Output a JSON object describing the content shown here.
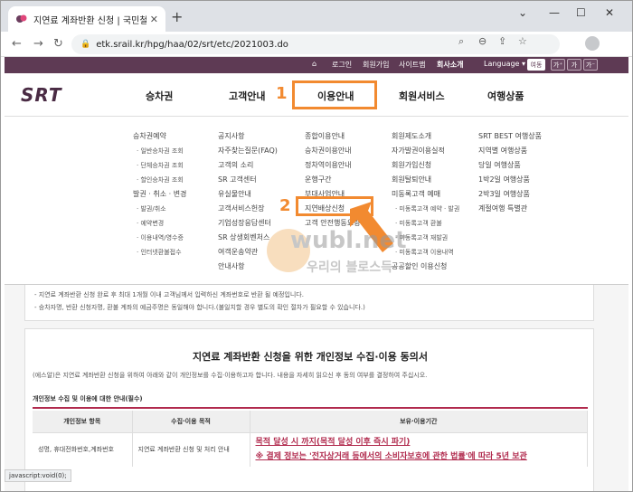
{
  "browser": {
    "tab_title": "지연료 계좌반환 신청 | 국민철도",
    "tab_close": "✕",
    "new_tab": "+",
    "url": "etk.srail.kr/hpg/haa/02/srt/etc/2021003.do",
    "status_text": "javascript:void(0);"
  },
  "utility": {
    "home_icon": "home-icon",
    "items": [
      "로그인",
      "회원가입",
      "사이트맵",
      "회사소개",
      "Language"
    ],
    "lang_arrow": "▾",
    "buttons": [
      "여동",
      "가⁺",
      "가",
      "가⁻"
    ]
  },
  "logo": "SRT",
  "nav": {
    "items": [
      "승차권",
      "고객안내",
      "이용안내",
      "회원서비스",
      "여행상품"
    ],
    "step1": "1",
    "step2": "2"
  },
  "mega": {
    "col1": [
      {
        "label": "승차권예약",
        "sub": false
      },
      {
        "label": "일반승차권 조회",
        "sub": true
      },
      {
        "label": "단체승차권 조회",
        "sub": true
      },
      {
        "label": "할인승차권 조회",
        "sub": true
      },
      {
        "label": "발권 · 취소 · 변경",
        "sub": false
      },
      {
        "label": "발권/취소",
        "sub": true
      },
      {
        "label": "예약변경",
        "sub": true
      },
      {
        "label": "이용내역/영수증",
        "sub": true
      },
      {
        "label": "인터넷환불접수",
        "sub": true
      }
    ],
    "col2": [
      {
        "label": "공지사항",
        "sub": false
      },
      {
        "label": "자주찾는질문(FAQ)",
        "sub": false
      },
      {
        "label": "고객의 소리",
        "sub": false
      },
      {
        "label": "SR 고객센터",
        "sub": false
      },
      {
        "label": "유실물안내",
        "sub": false
      },
      {
        "label": "고객서비스헌장",
        "sub": false
      },
      {
        "label": "기업성장응답센터",
        "sub": false
      },
      {
        "label": "SR 상생회벤처스",
        "sub": false
      },
      {
        "label": "여객운송약관",
        "sub": false
      },
      {
        "label": "안내사항",
        "sub": false
      }
    ],
    "col3": [
      {
        "label": "종합이용안내",
        "sub": false
      },
      {
        "label": "승차권이용안내",
        "sub": false
      },
      {
        "label": "정차역이용안내",
        "sub": false
      },
      {
        "label": "운행구간",
        "sub": false
      },
      {
        "label": "부대사업안내",
        "sub": false
      },
      {
        "label": "지연배상신청",
        "sub": false
      },
      {
        "label": "고객 안전행동요령",
        "sub": false
      }
    ],
    "col4": [
      {
        "label": "회원제도소개",
        "sub": false
      },
      {
        "label": "자가발권이용실적",
        "sub": false
      },
      {
        "label": "회원가입신청",
        "sub": false
      },
      {
        "label": "회원탈퇴안내",
        "sub": false
      },
      {
        "label": "미동록고객 예매",
        "sub": false
      },
      {
        "label": "미동록고객 예약 · 발권",
        "sub": true
      },
      {
        "label": "미동록고객 환불",
        "sub": true
      },
      {
        "label": "미동록고객 재발권",
        "sub": true
      },
      {
        "label": "미동록고객 이용내역",
        "sub": true
      },
      {
        "label": "공공할인 이용신청",
        "sub": false
      }
    ],
    "col5": [
      {
        "label": "SRT BEST 여행상품",
        "sub": false
      },
      {
        "label": "지역별 여행상품",
        "sub": false
      },
      {
        "label": "당일 여행상품",
        "sub": false
      },
      {
        "label": "1박2일 여행상품",
        "sub": false
      },
      {
        "label": "2박3일 여행상품",
        "sub": false
      },
      {
        "label": "계절여행 특별관",
        "sub": false
      }
    ]
  },
  "watermark": {
    "main": "wubl.net",
    "sub": "우리의 블로스득"
  },
  "notes": [
    "- 지연료 계좌반환 신청 완료 후 최대 1개월 이내 고객님께서 입력하신 계좌번호로 반환 될 예정입니다.",
    "- 승차자명, 반환 신청자명, 환불 계좌의 예금주명은 동일해야 합니다.(불일치할 경우 별도의 확인 절차가 필요할 수 있습니다.)"
  ],
  "consent": {
    "title": "지연료 계좌반환 신청을 위한 개인정보 수집·이용 동의서",
    "desc": "(에스알)은 지연료 계좌반환 신청을 위하여 아래와 같이 개인정보를 수집·이용하고자 합니다. 내용을 자세히 읽으신 후 동의 여부를 결정하여 주십시오.",
    "section_label": "개인정보 수집 및 이용에 대한 안내(필수)",
    "headers": [
      "개인정보 항목",
      "수집·이용 목적",
      "보유·이용기간"
    ],
    "row": {
      "items": "성명, 휴대전화번호,계좌번호",
      "purpose": "지연료 계좌반환 신청 및 처리 안내",
      "period1": "목적 달성 시 까지(목적 달성 이후 즉시 파기)",
      "period2": "※ 결제 정보는 '전자상거래 등에서의 소비자보호에 관한 법률'에 따라 5년 보관"
    }
  },
  "colors": {
    "brand": "#5e3a54",
    "highlight": "#f28a30",
    "accent": "#b12b4e"
  }
}
